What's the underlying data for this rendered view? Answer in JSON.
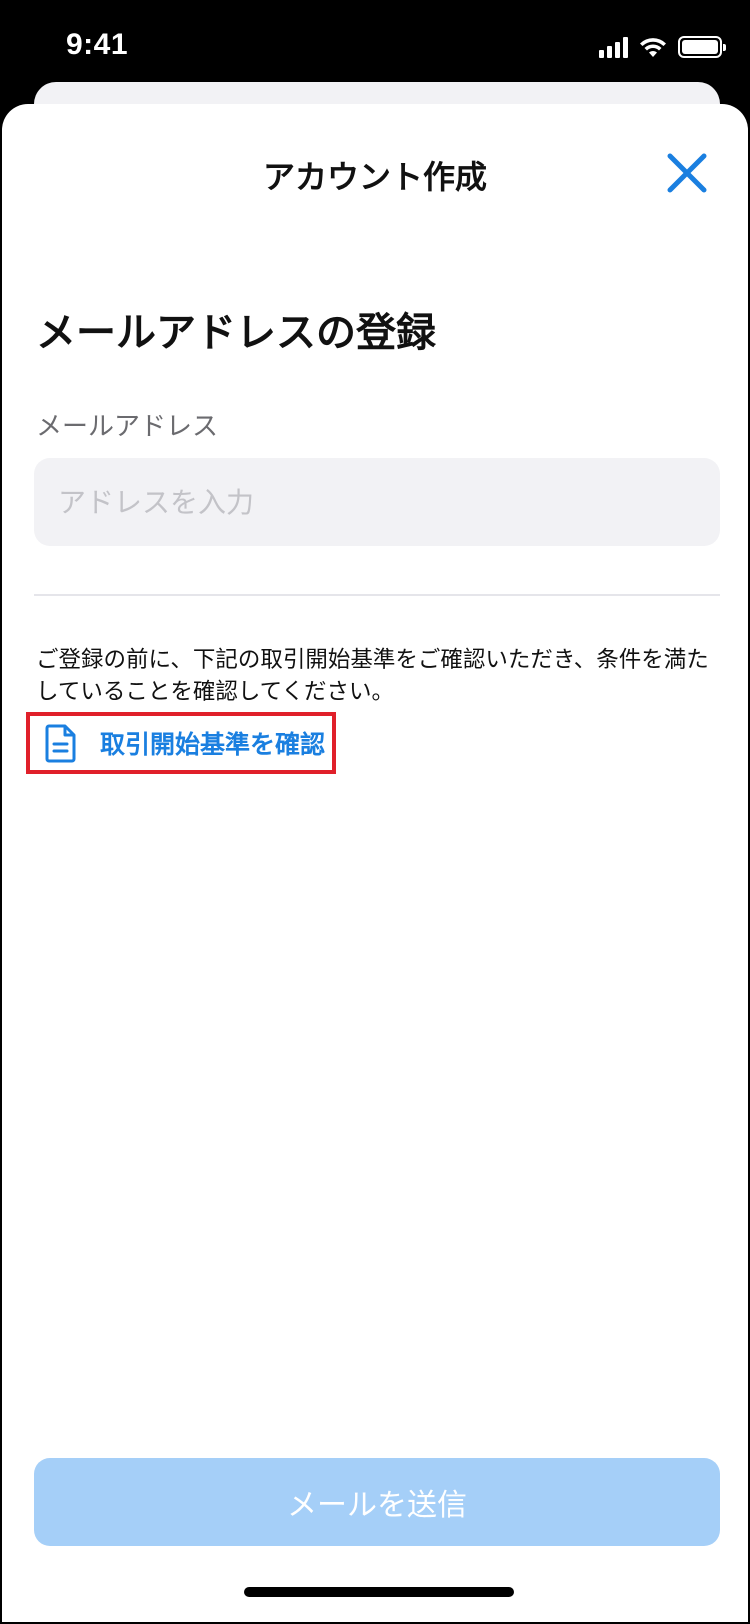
{
  "status_bar": {
    "time": "9:41"
  },
  "sheet": {
    "title": "アカウント作成",
    "close_icon": "close-icon"
  },
  "form": {
    "heading": "メールアドレスの登録",
    "email_label": "メールアドレス",
    "email_value": "",
    "email_placeholder": "アドレスを入力",
    "notice": "ご登録の前に、下記の取引開始基準をご確認いただき、条件を満たしていることを確認してください。",
    "criteria_link_label": "取引開始基準を確認",
    "criteria_link_icon": "document-icon",
    "send_button_label": "メールを送信"
  },
  "colors": {
    "accent": "#1a7fe0",
    "send_button_disabled": "#a5cff8",
    "input_background": "#f2f2f5",
    "highlight_box": "#e0202a"
  }
}
